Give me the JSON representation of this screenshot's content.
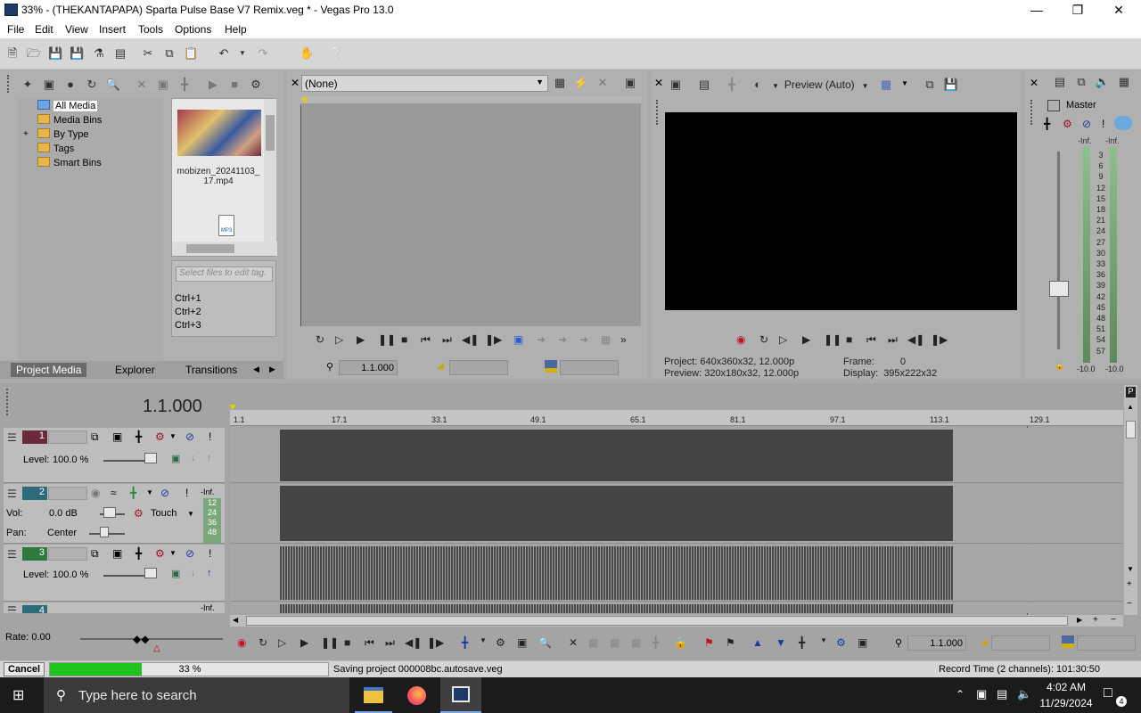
{
  "window": {
    "title": "33% - (THEKANTAPAPA) Sparta Pulse Base V7 Remix.veg * - Vegas Pro 13.0",
    "minimize_icon": "minimize-icon",
    "maximize_icon": "restore-icon",
    "close_icon": "close-icon"
  },
  "menu": [
    "File",
    "Edit",
    "View",
    "Insert",
    "Tools",
    "Options",
    "Help"
  ],
  "project_media": {
    "tree": [
      "All Media",
      "Media Bins",
      "By Type",
      "Tags",
      "Smart Bins"
    ],
    "expand_symbol": "+",
    "files": [
      {
        "name": "mobizen_20241103_17.mp4",
        "line1": "mobizen_20241103_",
        "line2": "17.mp4"
      },
      {
        "name": "MP3",
        "badge": "MP3"
      }
    ],
    "tag_placeholder": "Select files to edit tag.",
    "shortcuts": [
      "Ctrl+1",
      "Ctrl+2",
      "Ctrl+3"
    ],
    "tabs": [
      "Project Media",
      "Explorer",
      "Transitions"
    ]
  },
  "trimmer": {
    "dropdown_value": "(None)",
    "position": "1.1.000"
  },
  "preview": {
    "mode": "Preview (Auto)",
    "project_label": "Project:",
    "project_value": "640x360x32, 12.000p",
    "preview_label": "Preview:",
    "preview_value": "320x180x32, 12.000p",
    "frame_label": "Frame:",
    "frame_value": "0",
    "display_label": "Display:",
    "display_value": "395x222x32"
  },
  "master": {
    "label": "Master",
    "inf_left": "-Inf.",
    "inf_right": "-Inf.",
    "scale": [
      "3",
      "6",
      "9",
      "12",
      "15",
      "18",
      "21",
      "24",
      "27",
      "30",
      "33",
      "36",
      "39",
      "42",
      "45",
      "48",
      "51",
      "54",
      "57"
    ],
    "bottom_left": "-10.0",
    "bottom_right": "-10.0"
  },
  "timeline": {
    "position": "1.1.000",
    "ruler": [
      "1.1",
      "17.1",
      "33.1",
      "49.1",
      "65.1",
      "81.1",
      "97.1",
      "113.1",
      "129.1"
    ],
    "tracks": [
      {
        "number": "1",
        "level_label": "Level:",
        "level_value": "100.0 %"
      },
      {
        "number": "2",
        "vol_label": "Vol:",
        "vol_value": "0.0 dB",
        "automation": "Touch",
        "pan_label": "Pan:",
        "pan_value": "Center",
        "meter_top": "-Inf.",
        "meter_scale": [
          "12",
          "24",
          "36",
          "48"
        ]
      },
      {
        "number": "3",
        "level_label": "Level:",
        "level_value": "100.0 %"
      },
      {
        "number": "4",
        "meter_top": "-Inf."
      }
    ],
    "rate_label": "Rate:",
    "rate_value": "0.00",
    "transport_position": "1.1.000"
  },
  "status": {
    "cancel": "Cancel",
    "progress_text": "33 %",
    "progress": 0.33,
    "message": "Saving project 000008bc.autosave.veg",
    "record_time": "Record Time (2 channels): 101:30:50"
  },
  "taskbar": {
    "search_placeholder": "Type here to search",
    "time": "4:02 AM",
    "date": "11/29/2024",
    "notifications": "4"
  },
  "colors": {
    "track1": "#6a2a3a",
    "track2": "#2e6b7a",
    "track3": "#2e7a3e",
    "progress": "#1fc41f"
  }
}
